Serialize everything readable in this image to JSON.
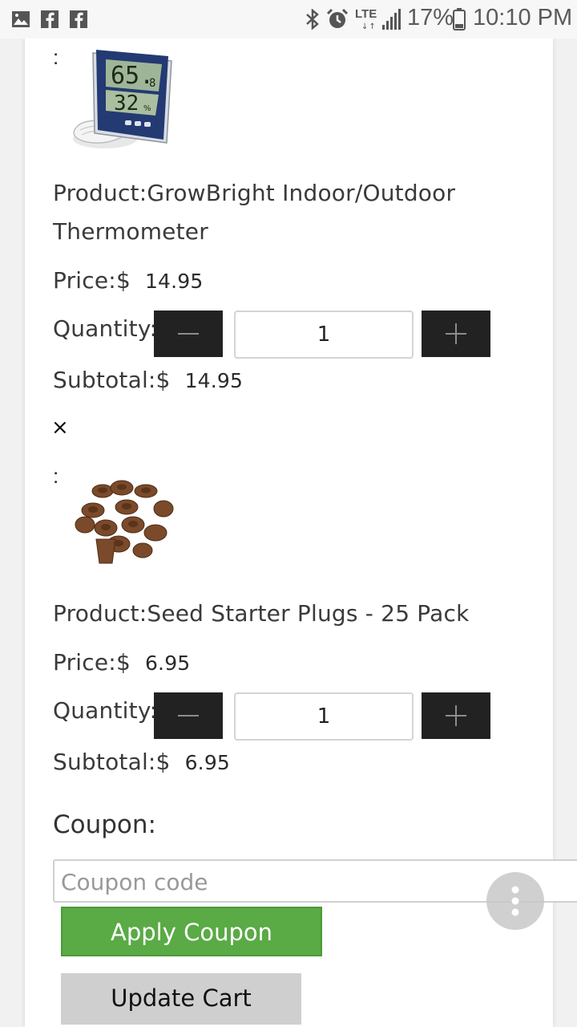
{
  "status_bar": {
    "battery": "17%",
    "time": "10:10 PM",
    "network": "LTE"
  },
  "cart": {
    "items": [
      {
        "colon": ":",
        "product_label": "Product:",
        "product_name": "GrowBright Indoor/Outdoor",
        "product_name_line2": "Thermometer",
        "price_label": "Price:$",
        "price": "14.95",
        "quantity_label": "Quantity:",
        "quantity": "1",
        "subtotal_label": "Subtotal:$",
        "subtotal": "14.95",
        "remove": "×"
      },
      {
        "colon": ":",
        "product_label": "Product:",
        "product_name": "Seed Starter Plugs - 25 Pack",
        "price_label": "Price:$",
        "price": "6.95",
        "quantity_label": "Quantity:",
        "quantity": "1",
        "subtotal_label": "Subtotal:$",
        "subtotal": "6.95"
      }
    ]
  },
  "coupon": {
    "label": "Coupon:",
    "placeholder": "Coupon code",
    "apply_label": "Apply Coupon"
  },
  "update_label": "Update Cart",
  "colors": {
    "apply_green": "#5aaa45",
    "qty_button": "#222222",
    "update_gray": "#cfcfcf"
  }
}
